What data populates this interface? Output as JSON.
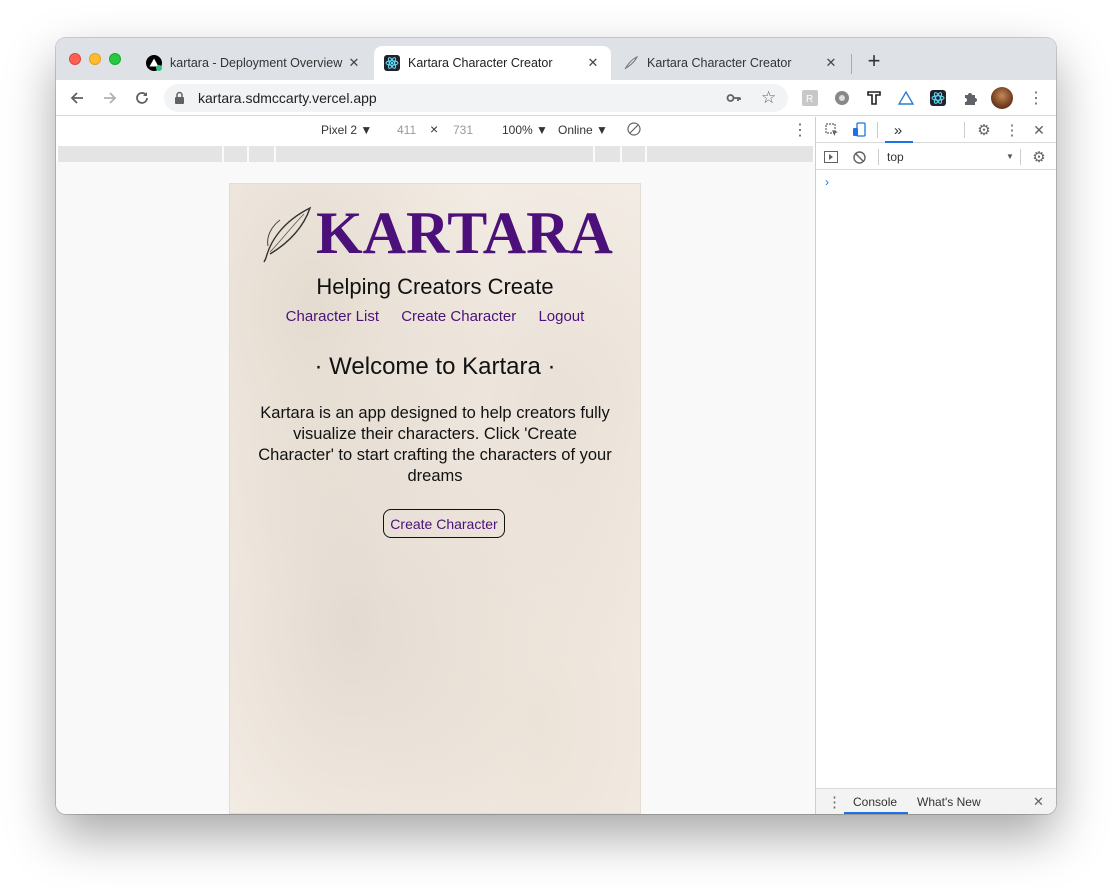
{
  "browser": {
    "tabs": [
      {
        "title": "kartara - Deployment Overview",
        "active": false
      },
      {
        "title": "Kartara Character Creator",
        "active": true
      },
      {
        "title": "Kartara Character Creator",
        "active": false
      }
    ],
    "url": "kartara.sdmccarty.vercel.app"
  },
  "device_toolbar": {
    "device": "Pixel 2 ▼",
    "width": "411",
    "times": "×",
    "height": "731",
    "zoom": "100% ▼",
    "network": "Online ▼"
  },
  "page": {
    "brand": "KARTARA",
    "tagline": "Helping Creators Create",
    "nav": [
      "Character List",
      "Create Character",
      "Logout"
    ],
    "welcome": "· Welcome to Kartara ·",
    "intro": "Kartara is an app designed to help creators fully visualize their characters. Click 'Create Character' to start crafting the characters of your dreams",
    "cta": "Create Character",
    "brand_color": "#4b1079"
  },
  "devtools": {
    "more_tabs": "»",
    "context": "top",
    "prompt": "›",
    "drawer_tabs": [
      "Console",
      "What's New"
    ]
  }
}
